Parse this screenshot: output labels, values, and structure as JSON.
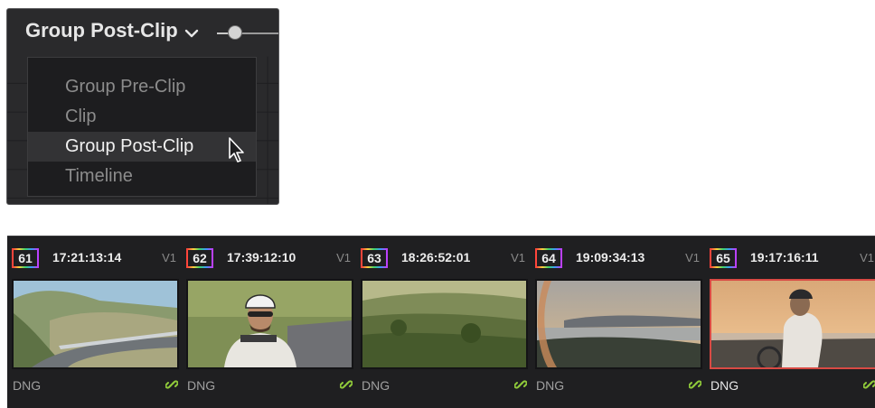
{
  "node_mode": {
    "current": "Group Post-Clip",
    "menu_items": [
      {
        "label": "Group Pre-Clip",
        "state": "normal"
      },
      {
        "label": "Clip",
        "state": "normal"
      },
      {
        "label": "Group Post-Clip",
        "state": "highlighted"
      },
      {
        "label": "Timeline",
        "state": "normal"
      }
    ]
  },
  "clips": [
    {
      "number": "61",
      "timecode": "17:21:13:14",
      "track": "V1",
      "format": "DNG",
      "selected": false,
      "scene": "coastal-road"
    },
    {
      "number": "62",
      "timecode": "17:39:12:10",
      "track": "V1",
      "format": "DNG",
      "selected": false,
      "scene": "cyclist-closeup"
    },
    {
      "number": "63",
      "timecode": "18:26:52:01",
      "track": "V1",
      "format": "DNG",
      "selected": false,
      "scene": "green-hillside"
    },
    {
      "number": "64",
      "timecode": "19:09:34:13",
      "track": "V1",
      "format": "DNG",
      "selected": false,
      "scene": "sunset-bay"
    },
    {
      "number": "65",
      "timecode": "19:17:16:11",
      "track": "V1",
      "format": "DNG",
      "selected": true,
      "scene": "cyclist-silhouette"
    }
  ],
  "colors": {
    "selection_border": "#d94a44",
    "link_icon": "#8fc93a",
    "panel_bg": "#2a2a2c"
  }
}
